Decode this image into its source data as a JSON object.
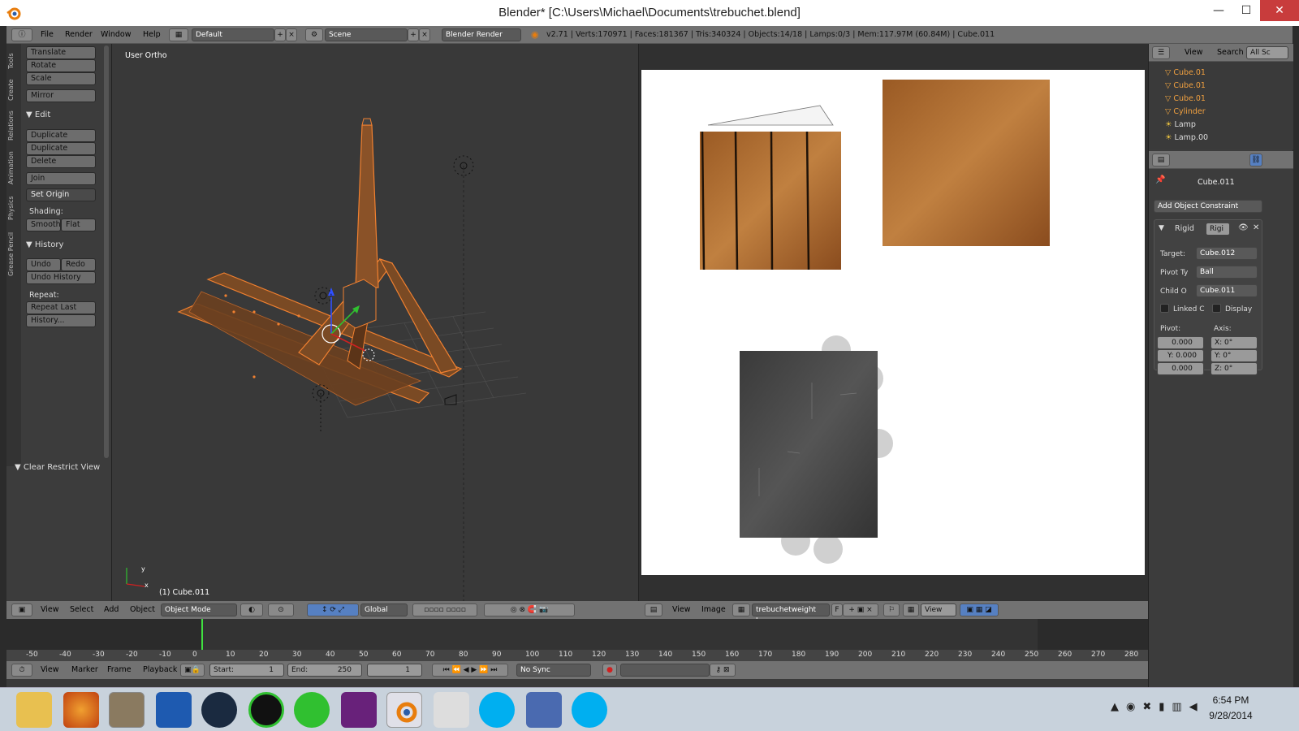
{
  "window": {
    "title": "Blender* [C:\\Users\\Michael\\Documents\\trebuchet.blend]",
    "minimize": "—",
    "maximize": "☐",
    "close": "✕"
  },
  "info_header": {
    "menus": [
      "File",
      "Render",
      "Window",
      "Help"
    ],
    "layout": "Default",
    "scene": "Scene",
    "engine": "Blender Render",
    "stats": "v2.71 | Verts:170971 | Faces:181367 | Tris:340324 | Objects:14/18 | Lamps:0/3 | Mem:117.97M (60.84M) | Cube.011"
  },
  "toolshelf": {
    "tabs": [
      "Tools",
      "Create",
      "Relations",
      "Animation",
      "Physics",
      "Grease Pencil"
    ],
    "transform": [
      "Translate",
      "Rotate",
      "Scale",
      "Mirror"
    ],
    "edit_header": "Edit",
    "edit": [
      "Duplicate",
      "Duplicate Linked",
      "Delete",
      "Join"
    ],
    "set_origin": "Set Origin",
    "shading_label": "Shading:",
    "smooth": "Smooth",
    "flat": "Flat",
    "history_header": "History",
    "undo": "Undo",
    "redo": "Redo",
    "undo_history": "Undo History",
    "repeat_label": "Repeat:",
    "repeat_last": "Repeat Last",
    "history": "History...",
    "clear_restrict": "Clear Restrict View"
  },
  "viewport": {
    "label": "User Ortho",
    "object": "(1) Cube.011",
    "axis_x": "x",
    "axis_y": "y"
  },
  "viewport_header": {
    "menus": [
      "View",
      "Select",
      "Add",
      "Object"
    ],
    "mode": "Object Mode",
    "orientation": "Global"
  },
  "image_header": {
    "menus": [
      "View",
      "Image"
    ],
    "image_name": "trebuchetweight bo...",
    "f": "F",
    "view": "View"
  },
  "outliner": {
    "menus": [
      "View",
      "Search",
      "All Sc"
    ],
    "items": [
      {
        "name": "Cube.01"
      },
      {
        "name": "Cube.01"
      },
      {
        "name": "Cube.01"
      },
      {
        "name": "Cylinder"
      },
      {
        "name": "Lamp"
      },
      {
        "name": "Lamp.00"
      }
    ]
  },
  "properties": {
    "object": "Cube.011",
    "add_constraint": "Add Object Constraint",
    "constraint_type": "Rigid",
    "constraint_name": "Rigi",
    "target_label": "Target:",
    "target": "Cube.012",
    "pivot_type_label": "Pivot Ty",
    "pivot_type": "Ball",
    "child_label": "Child O",
    "child": "Cube.011",
    "linked": "Linked C",
    "display": "Display",
    "pivot_label": "Pivot:",
    "axis_label": "Axis:",
    "pivot_values": [
      "0.000",
      "Y: 0.000",
      "0.000"
    ],
    "axis_values": [
      "X:      0°",
      "Y:      0°",
      "Z:      0°"
    ]
  },
  "timeline": {
    "ticks": [
      "-50",
      "-40",
      "-30",
      "-20",
      "-10",
      "0",
      "10",
      "20",
      "30",
      "40",
      "50",
      "60",
      "70",
      "80",
      "90",
      "100",
      "110",
      "120",
      "130",
      "140",
      "150",
      "160",
      "170",
      "180",
      "190",
      "200",
      "210",
      "220",
      "230",
      "240",
      "250",
      "260",
      "270",
      "280"
    ],
    "menus": [
      "View",
      "Marker",
      "Frame",
      "Playback"
    ],
    "start": "Start:",
    "start_val": "1",
    "end": "End:",
    "end_val": "250",
    "current": "1",
    "sync": "No Sync"
  },
  "taskbar": {
    "time": "6:54 PM",
    "date": "9/28/2014"
  },
  "colors": {
    "accent": "#f08030",
    "blender_orange": "#e87d0d",
    "header_gray": "#727272"
  }
}
